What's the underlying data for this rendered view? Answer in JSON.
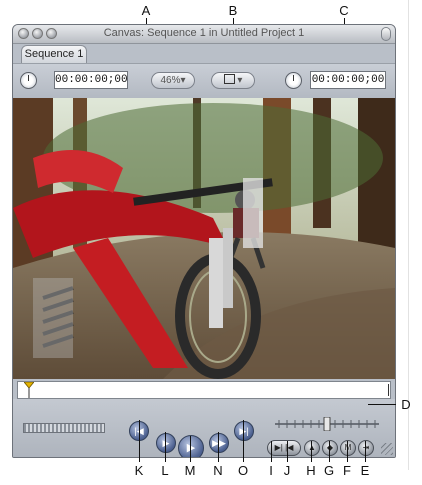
{
  "window": {
    "title": "Canvas: Sequence 1 in Untitled Project 1"
  },
  "tab": {
    "label": "Sequence 1"
  },
  "toolbar": {
    "duration_timecode": "00:00:00;00",
    "zoom": "46%",
    "current_timecode": "00:00:00;00"
  },
  "callouts": {
    "top": [
      "A",
      "B",
      "C"
    ],
    "right": [
      "D"
    ],
    "bottom": [
      "K",
      "L",
      "M",
      "N",
      "O",
      "I",
      "J",
      "H",
      "G",
      "F",
      "E"
    ]
  },
  "icons": {
    "clock_left": "clock-icon",
    "clock_right": "clock-icon",
    "view_popup": "view-options-icon",
    "play": "play-icon",
    "grip": "resize-grip-icon"
  }
}
